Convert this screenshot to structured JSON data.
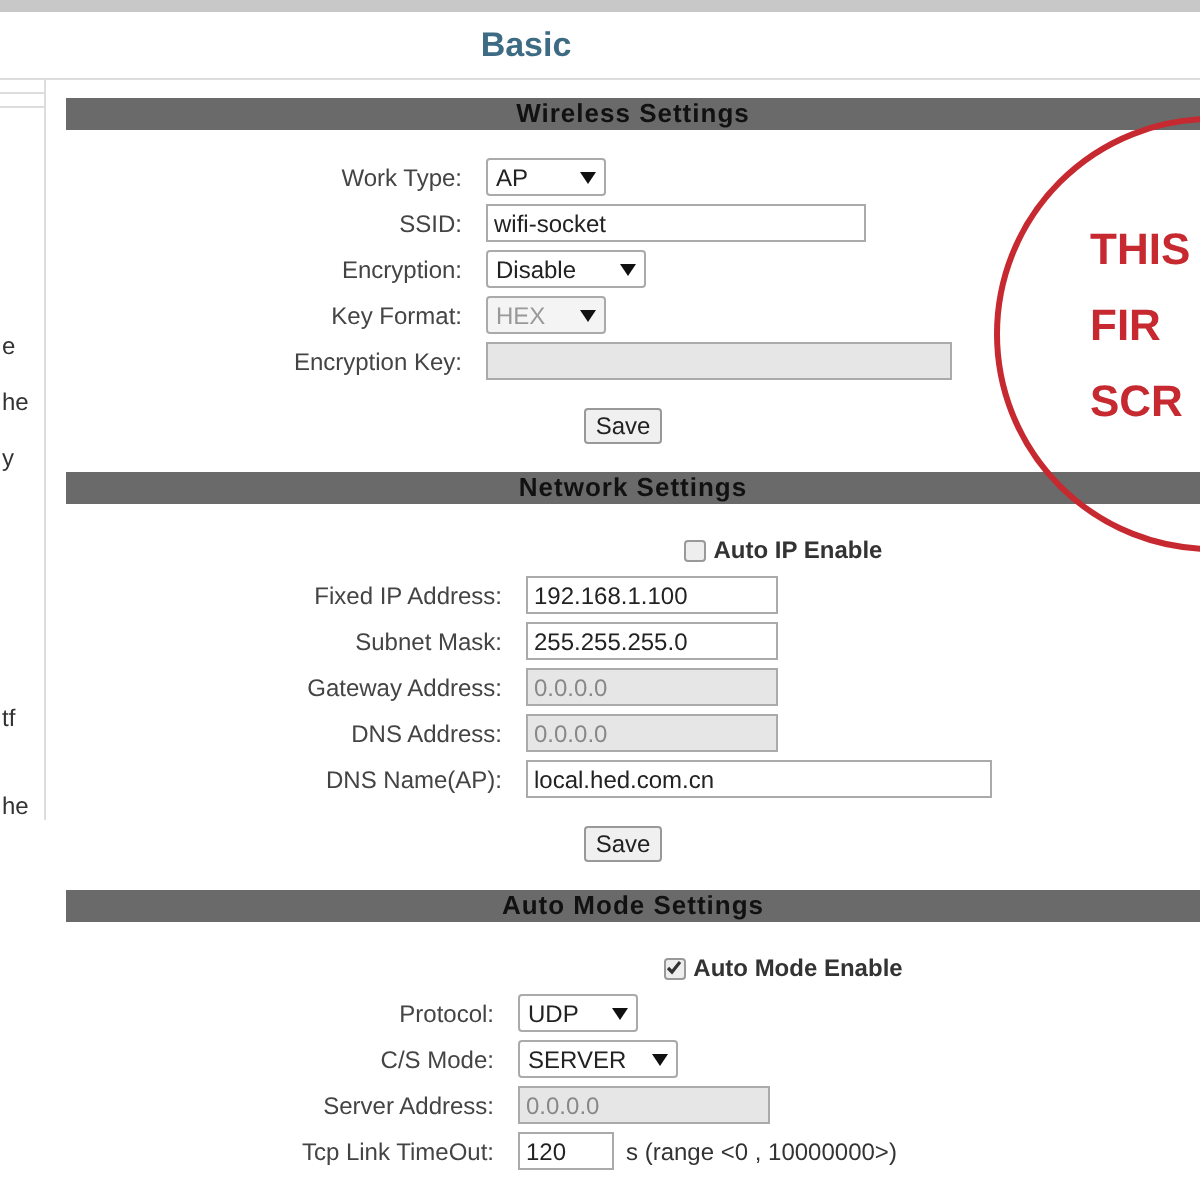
{
  "page_title": "Basic",
  "sidebar": {
    "fragments": [
      "e",
      "he",
      "y",
      "tf",
      "he"
    ]
  },
  "sections": [
    {
      "title": "Wireless Settings",
      "fields": [
        {
          "kind": "select",
          "label": "Work Type:",
          "value": "AP",
          "disabled": false
        },
        {
          "kind": "input",
          "label": "SSID:",
          "value": "wifi-socket",
          "disabled": false
        },
        {
          "kind": "select",
          "label": "Encryption:",
          "value": "Disable",
          "disabled": false
        },
        {
          "kind": "select",
          "label": "Key Format:",
          "value": "HEX",
          "disabled": true
        },
        {
          "kind": "input",
          "label": "Encryption Key:",
          "disabled": true
        }
      ],
      "button": "Save"
    },
    {
      "title": "Network Settings",
      "checkbox": {
        "label": "Auto IP Enable",
        "checked": false
      },
      "fields": [
        {
          "kind": "input",
          "label": "Fixed IP Address:",
          "value": "192.168.1.100",
          "disabled": false
        },
        {
          "kind": "input",
          "label": "Subnet Mask:",
          "value": "255.255.255.0",
          "disabled": false
        },
        {
          "kind": "input",
          "label": "Gateway Address:",
          "value": "0.0.0.0",
          "disabled": true
        },
        {
          "kind": "input",
          "label": "DNS Address:",
          "value": "0.0.0.0",
          "disabled": true
        },
        {
          "kind": "input",
          "label": "DNS Name(AP):",
          "value": "local.hed.com.cn",
          "disabled": false
        }
      ],
      "button": "Save"
    },
    {
      "title": "Auto Mode Settings",
      "checkbox": {
        "label": "Auto Mode Enable",
        "checked": true
      },
      "fields": [
        {
          "kind": "select",
          "label": "Protocol:",
          "value": "UDP",
          "disabled": false
        },
        {
          "kind": "select",
          "label": "C/S Mode:",
          "value": "SERVER",
          "disabled": false
        },
        {
          "kind": "input",
          "label": "Server Address:",
          "value": "0.0.0.0",
          "disabled": true
        },
        {
          "kind": "input",
          "label": "Tcp Link TimeOut:",
          "value": "120",
          "disabled": false,
          "suffix": "s (range <0 , 10000000>)"
        }
      ]
    }
  ],
  "annotation": {
    "lines": [
      "THIS",
      "FIR",
      "SCR"
    ]
  }
}
